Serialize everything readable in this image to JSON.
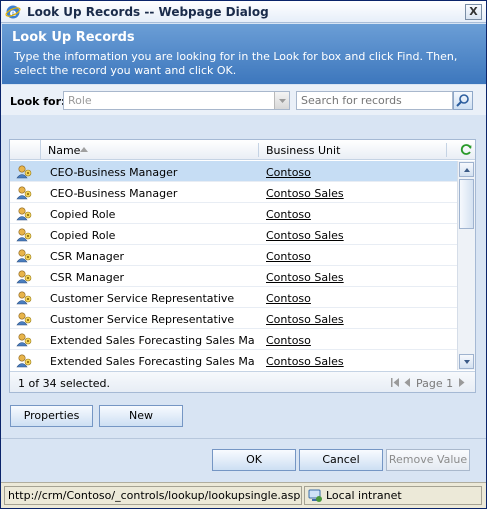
{
  "window": {
    "title": "Look Up Records -- Webpage Dialog",
    "close_label": "X"
  },
  "banner": {
    "title": "Look Up Records",
    "instructions": "Type the information you are looking for in the Look for box and click Find. Then, select the record you want and click OK."
  },
  "lookfor": {
    "label": "Look for:",
    "selected": "Role",
    "search_placeholder": "Search for records"
  },
  "grid": {
    "columns": {
      "name": "Name",
      "business_unit": "Business Unit"
    },
    "rows": [
      {
        "name": "CEO-Business Manager",
        "business_unit": "Contoso",
        "selected": true
      },
      {
        "name": "CEO-Business Manager",
        "business_unit": "Contoso Sales",
        "selected": false
      },
      {
        "name": "Copied Role",
        "business_unit": "Contoso",
        "selected": false
      },
      {
        "name": "Copied Role",
        "business_unit": "Contoso Sales",
        "selected": false
      },
      {
        "name": "CSR Manager",
        "business_unit": "Contoso",
        "selected": false
      },
      {
        "name": "CSR Manager",
        "business_unit": "Contoso Sales",
        "selected": false
      },
      {
        "name": "Customer Service Representative",
        "business_unit": "Contoso",
        "selected": false
      },
      {
        "name": "Customer Service Representative",
        "business_unit": "Contoso Sales",
        "selected": false
      },
      {
        "name": "Extended Sales Forecasting Sales Mana...",
        "business_unit": "Contoso",
        "selected": false
      },
      {
        "name": "Extended Sales Forecasting Sales Mana...",
        "business_unit": "Contoso Sales",
        "selected": false
      }
    ],
    "footer": {
      "selected_count": "1 of 34 selected.",
      "page_label": "Page 1"
    }
  },
  "buttons": {
    "properties": "Properties",
    "new": "New",
    "ok": "OK",
    "cancel": "Cancel",
    "remove_value": "Remove Value"
  },
  "statusbar": {
    "url": "http://crm/Contoso/_controls/lookup/lookupsingle.aspx?class=",
    "zone": "Local intranet"
  },
  "colors": {
    "banner": "#4f87c9",
    "selected_row": "#c6ddf4",
    "accent_border": "#7596c4"
  }
}
